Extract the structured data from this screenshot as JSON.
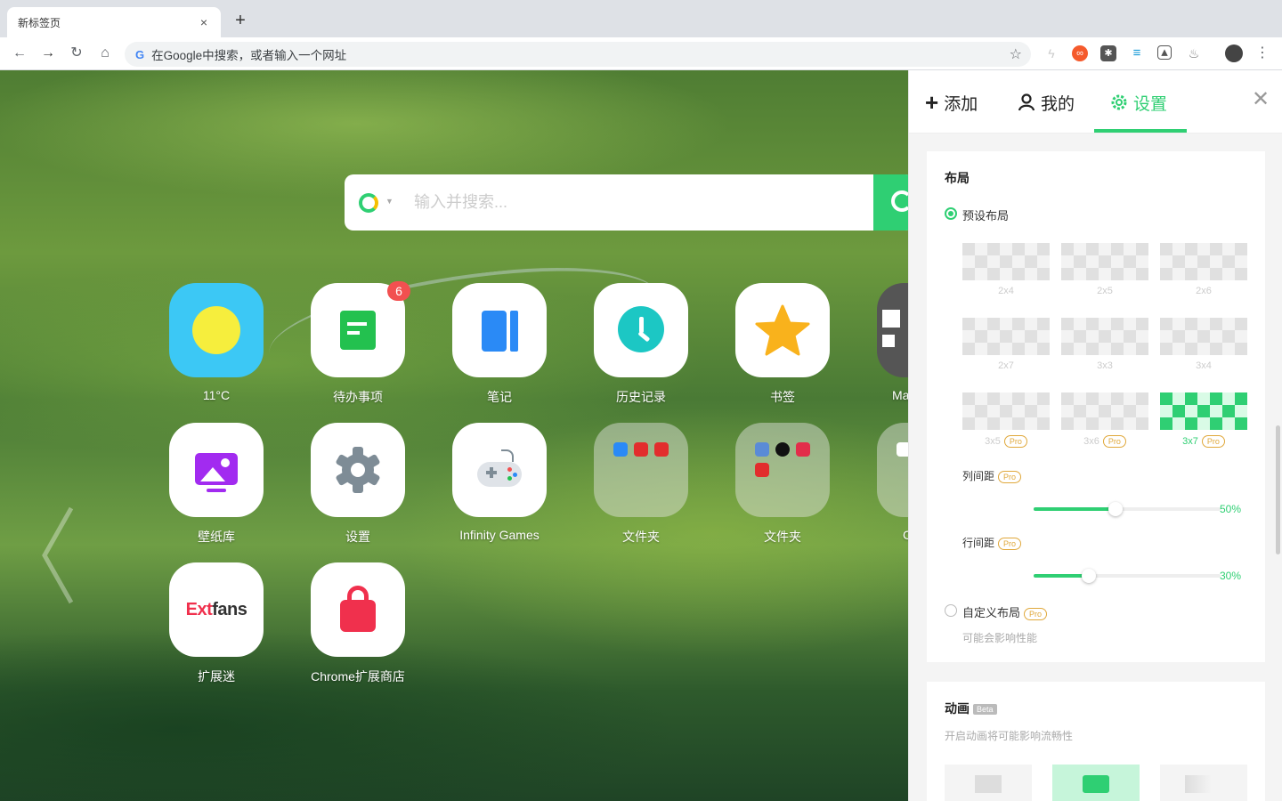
{
  "browser": {
    "tab_title": "新标签页",
    "tab_close": "×",
    "new_tab": "+",
    "omnibox_g": "G",
    "omnibox_placeholder": "在Google中搜索，或者输入一个网址"
  },
  "search": {
    "placeholder": "输入并搜索..."
  },
  "apps": [
    {
      "label": "11°C",
      "icon": "weather-sun-icon"
    },
    {
      "label": "待办事项",
      "icon": "todo-icon",
      "badge": "6"
    },
    {
      "label": "笔记",
      "icon": "notes-icon"
    },
    {
      "label": "历史记录",
      "icon": "clock-icon"
    },
    {
      "label": "书签",
      "icon": "star-icon"
    },
    {
      "label": "Ma",
      "icon": "partial-app-icon"
    },
    {
      "label": "壁纸库",
      "icon": "wallpaper-icon"
    },
    {
      "label": "设置",
      "icon": "gear-icon"
    },
    {
      "label": "Infinity Games",
      "icon": "gamepad-icon"
    },
    {
      "label": "文件夹",
      "icon": "folder-icon"
    },
    {
      "label": "文件夹",
      "icon": "folder-icon"
    },
    {
      "label": "C",
      "icon": "partial-app-icon"
    },
    {
      "label": "扩展迷",
      "icon": "extfans-logo",
      "logo_text_a": "Ext",
      "logo_text_b": "fans"
    },
    {
      "label": "Chrome扩展商店",
      "icon": "shopping-bag-icon"
    }
  ],
  "panel": {
    "tabs": [
      {
        "label": "添加",
        "icon": "plus-icon"
      },
      {
        "label": "我的",
        "icon": "user-icon"
      },
      {
        "label": "设置",
        "icon": "gear-icon",
        "active": true
      }
    ],
    "layout": {
      "title": "布局",
      "preset_label": "预设布局",
      "grids": [
        "2x4",
        "2x5",
        "2x6",
        "2x7",
        "3x3",
        "3x4",
        "3x5",
        "3x6",
        "3x7"
      ],
      "pro": "Pro",
      "col_gap_label": "列间距",
      "col_gap_value": "50%",
      "col_gap_level": 0.5,
      "row_gap_label": "行间距",
      "row_gap_value": "30%",
      "row_gap_level": 0.3,
      "custom_label": "自定义布局",
      "custom_sub": "可能会影响性能"
    },
    "animation": {
      "title": "动画",
      "beta": "Beta",
      "sub": "开启动画将可能影响流畅性"
    }
  },
  "colors": {
    "accent": "#2fcf73",
    "pro": "#e0a83b",
    "badge": "#f25050"
  }
}
